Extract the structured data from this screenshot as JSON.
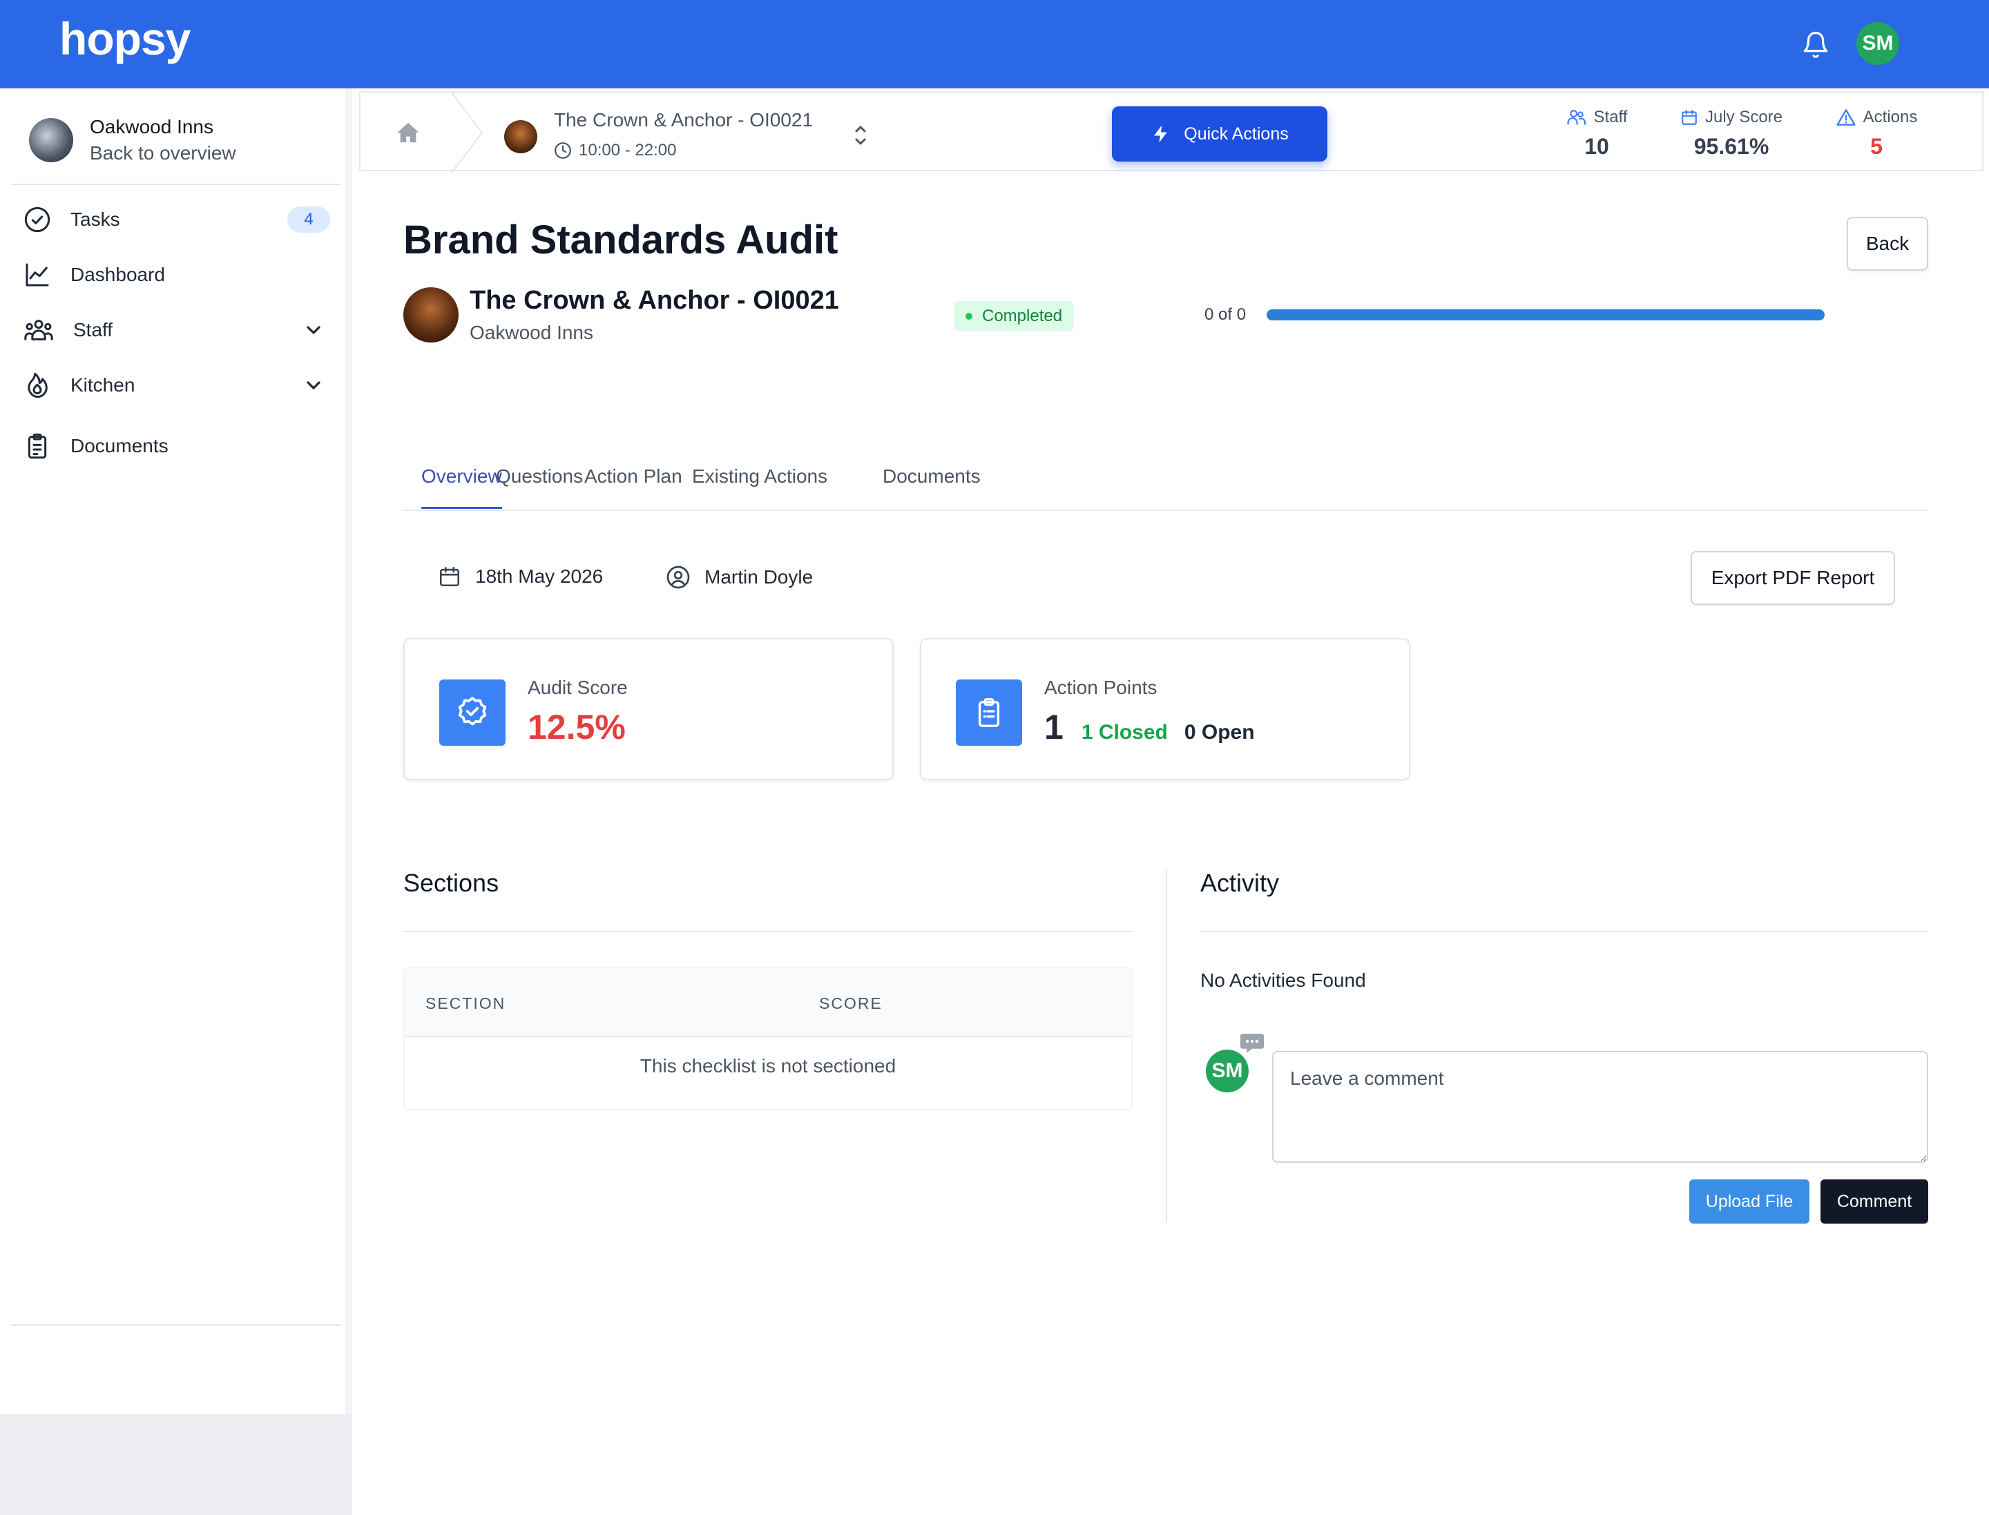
{
  "brand": {
    "logo_text": "hopsy",
    "color": "#2a68e6"
  },
  "user": {
    "initials": "SM",
    "avatar_color": "#22a55a"
  },
  "sidebar": {
    "org_name": "Oakwood Inns",
    "back_label": "Back to overview",
    "items": [
      {
        "label": "Tasks",
        "icon": "check-circle-icon",
        "badge": "4"
      },
      {
        "label": "Dashboard",
        "icon": "chart-line-icon"
      },
      {
        "label": "Staff",
        "icon": "users-icon",
        "expandable": true
      },
      {
        "label": "Kitchen",
        "icon": "flame-icon",
        "expandable": true
      },
      {
        "label": "Documents",
        "icon": "clipboard-icon"
      }
    ]
  },
  "subbar": {
    "location_name": "The Crown & Anchor - OI0021",
    "hours": "10:00 - 22:00",
    "quick_actions_label": "Quick Actions",
    "stats": [
      {
        "label": "Staff",
        "value": "10",
        "icon": "users-icon"
      },
      {
        "label": "July Score",
        "value": "95.61%",
        "icon": "calendar-icon"
      },
      {
        "label": "Actions",
        "value": "5",
        "icon": "warning-icon",
        "value_color": "#e53e3e"
      }
    ]
  },
  "page": {
    "title": "Brand Standards Audit",
    "back_label": "Back",
    "site_name": "The Crown & Anchor - OI0021",
    "site_org": "Oakwood Inns",
    "status": "Completed",
    "progress_label": "0 of 0",
    "progress_fraction": 1.0
  },
  "tabs": [
    {
      "label": "Overview",
      "active": true
    },
    {
      "label": "Questions"
    },
    {
      "label": "Action Plan"
    },
    {
      "label": "Existing Actions"
    },
    {
      "label": "Documents"
    }
  ],
  "meta": {
    "date": "18th May 2026",
    "auditor": "Martin Doyle",
    "export_label": "Export PDF Report"
  },
  "cards": {
    "audit_score": {
      "label": "Audit Score",
      "value": "12.5%",
      "value_color": "#e53e3e"
    },
    "action_points": {
      "label": "Action Points",
      "total": "1",
      "closed": "1 Closed",
      "open": "0 Open"
    }
  },
  "sections": {
    "title": "Sections",
    "columns": [
      "SECTION",
      "SCORE"
    ],
    "empty_text": "This checklist is not sectioned"
  },
  "activity": {
    "title": "Activity",
    "empty_text": "No Activities Found",
    "comment_placeholder": "Leave a comment",
    "upload_label": "Upload File",
    "comment_label": "Comment"
  }
}
